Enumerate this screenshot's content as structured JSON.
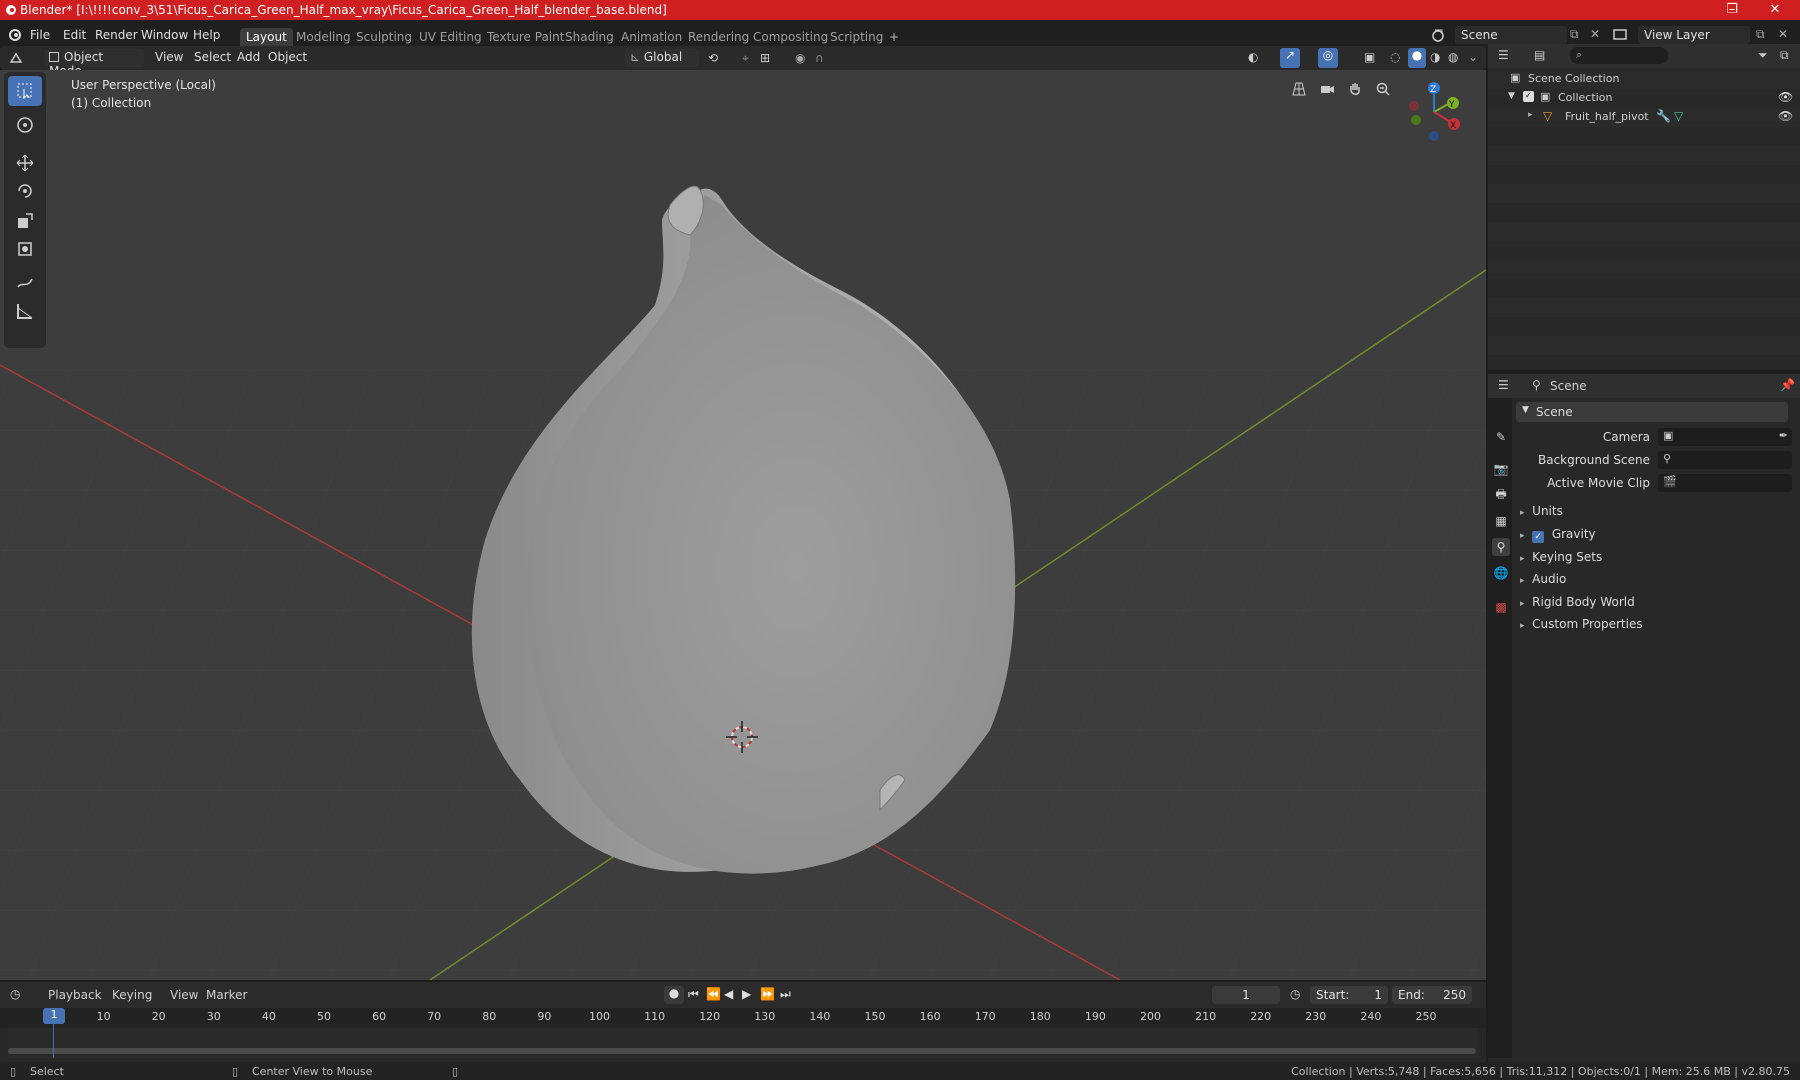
{
  "window": {
    "title": "Blender* [I:\\!!!!conv_3\\51\\Ficus_Carica_Green_Half_max_vray\\Ficus_Carica_Green_Half_blender_base.blend]",
    "minimize": "–",
    "maximize": "❐",
    "close": "✕"
  },
  "menu": [
    "File",
    "Edit",
    "Render",
    "Window",
    "Help"
  ],
  "workspaces": [
    "Layout",
    "Modeling",
    "Sculpting",
    "UV Editing",
    "Texture Paint",
    "Shading",
    "Animation",
    "Rendering",
    "Compositing",
    "Scripting"
  ],
  "workspace_add": "+",
  "scene_field": "Scene",
  "view_layer_field": "View Layer",
  "viewport_header": {
    "mode": "Object Mode",
    "view": "View",
    "select": "Select",
    "add": "Add",
    "object": "Object",
    "orientation": "Global"
  },
  "viewport": {
    "perspective": "User Perspective (Local)",
    "collection": "(1) Collection"
  },
  "gizmo": {
    "z": "Z",
    "y": "Y",
    "x": "X"
  },
  "outliner": {
    "search_placeholder": "",
    "scene_collection": "Scene Collection",
    "collection": "Collection",
    "object": "Fruit_half_pivot"
  },
  "properties": {
    "context": "Scene",
    "panel": "Scene",
    "camera_label": "Camera",
    "background_scene_label": "Background Scene",
    "movie_clip_label": "Active Movie Clip",
    "sections": [
      "Units",
      "Gravity",
      "Keying Sets",
      "Audio",
      "Rigid Body World",
      "Custom Properties"
    ],
    "gravity_checked": true
  },
  "timeline": {
    "playback": "Playback",
    "keying": "Keying",
    "view": "View",
    "marker": "Marker",
    "current_frame": "1",
    "start_label": "Start:",
    "start": "1",
    "end_label": "End:",
    "end": "250",
    "ticks": [
      "1",
      "10",
      "20",
      "30",
      "40",
      "50",
      "60",
      "70",
      "80",
      "90",
      "100",
      "110",
      "120",
      "130",
      "140",
      "150",
      "160",
      "170",
      "180",
      "190",
      "200",
      "210",
      "220",
      "230",
      "240",
      "250"
    ]
  },
  "status": {
    "select": "Select",
    "center": "Center View to Mouse",
    "stats": "Collection | Verts:5,748 | Faces:5,656 | Tris:11,312 | Objects:0/1 | Mem: 25.6 MB | v2.80.75"
  },
  "colors": {
    "title_bar": "#cf1f21",
    "accent": "#4772b3",
    "x_axis": "#c8303a",
    "y_axis": "#7fb022",
    "z_axis": "#2f7ad0"
  }
}
